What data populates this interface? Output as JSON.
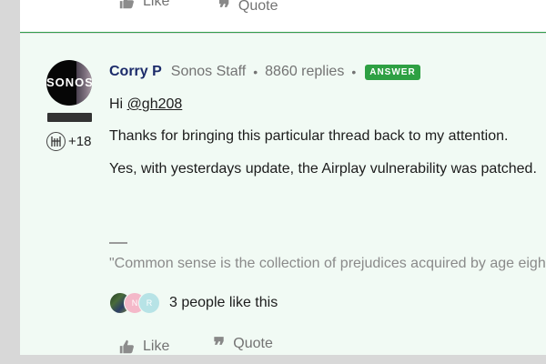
{
  "previous_post": {
    "like_label": "Like",
    "quote_label": "Quote"
  },
  "post": {
    "author": "Corry P",
    "role": "Sonos Staff",
    "separator": "•",
    "replies": "8860 replies",
    "answer_badge": "ANSWER",
    "avatar_text": "SONOS",
    "badge_count": "+18",
    "greeting": "Hi ",
    "mention": "@gh208",
    "paragraph_1": "Thanks for bringing this particular thread back to my attention.",
    "paragraph_2": "Yes, with yesterdays update, the Airplay vulnerability was patched.",
    "signature": "\"Common sense is the collection of prejudices acquired by age eighteen.\"",
    "likes": {
      "avatars": [
        "",
        "N",
        "R"
      ],
      "text": "3 people like this"
    },
    "actions": {
      "like_label": "Like",
      "quote_label": "Quote"
    }
  },
  "colors": {
    "post_background": "#f1faf4",
    "separator_green": "#2e9f4a",
    "answer_badge": "#2ea043",
    "author": "#1c2b6a"
  },
  "icons": [
    "thumbs-up-icon",
    "quote-icon",
    "award-badge-icon"
  ]
}
